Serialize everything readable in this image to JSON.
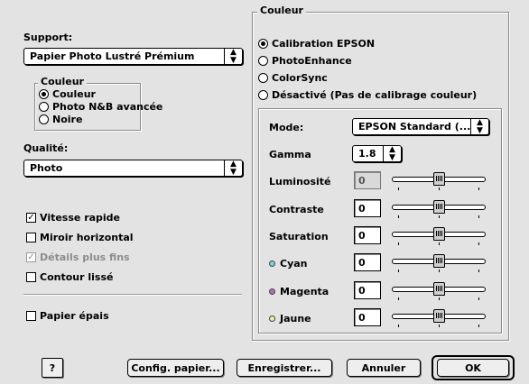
{
  "left": {
    "support_label": "Support:",
    "support_value": "Papier Photo Lustré Prémium",
    "couleur_group": {
      "title": "Couleur",
      "options": [
        {
          "label": "Couleur",
          "selected": true
        },
        {
          "label": "Photo N&B avancée",
          "selected": false
        },
        {
          "label": "Noire",
          "selected": false
        }
      ]
    },
    "qualite_label": "Qualité:",
    "qualite_value": "Photo",
    "checks": [
      {
        "label": "Vitesse rapide",
        "checked": true,
        "enabled": true
      },
      {
        "label": "Miroir horizontal",
        "checked": false,
        "enabled": true
      },
      {
        "label": "Détails plus fins",
        "checked": true,
        "enabled": false
      },
      {
        "label": "Contour lissé",
        "checked": false,
        "enabled": true
      }
    ],
    "papier_epais": {
      "label": "Papier épais",
      "checked": false
    }
  },
  "right": {
    "title": "Couleur",
    "options": [
      {
        "label": "Calibration EPSON",
        "selected": true
      },
      {
        "label": "PhotoEnhance",
        "selected": false
      },
      {
        "label": "ColorSync",
        "selected": false
      },
      {
        "label": "Désactivé (Pas de calibrage couleur)",
        "selected": false
      }
    ],
    "mode_label": "Mode:",
    "mode_value": "EPSON Standard (...",
    "gamma_label": "Gamma",
    "gamma_value": "1.8",
    "adjustments": [
      {
        "label": "Luminosité",
        "value": "0",
        "enabled": false,
        "dot_color": ""
      },
      {
        "label": "Contraste",
        "value": "0",
        "enabled": true,
        "dot_color": ""
      },
      {
        "label": "Saturation",
        "value": "0",
        "enabled": true,
        "dot_color": ""
      },
      {
        "label": "Cyan",
        "value": "0",
        "enabled": true,
        "dot_color": "#7fd3d3"
      },
      {
        "label": "Magenta",
        "value": "0",
        "enabled": true,
        "dot_color": "#b86bb8"
      },
      {
        "label": "Jaune",
        "value": "0",
        "enabled": true,
        "dot_color": "#f0f0a0"
      }
    ]
  },
  "buttons": {
    "help": "?",
    "config": "Config. papier...",
    "save": "Enregistrer...",
    "cancel": "Annuler",
    "ok": "OK"
  },
  "icons": {
    "popup_arrows": "up-down-arrow-icon",
    "check": "checkmark-icon"
  }
}
